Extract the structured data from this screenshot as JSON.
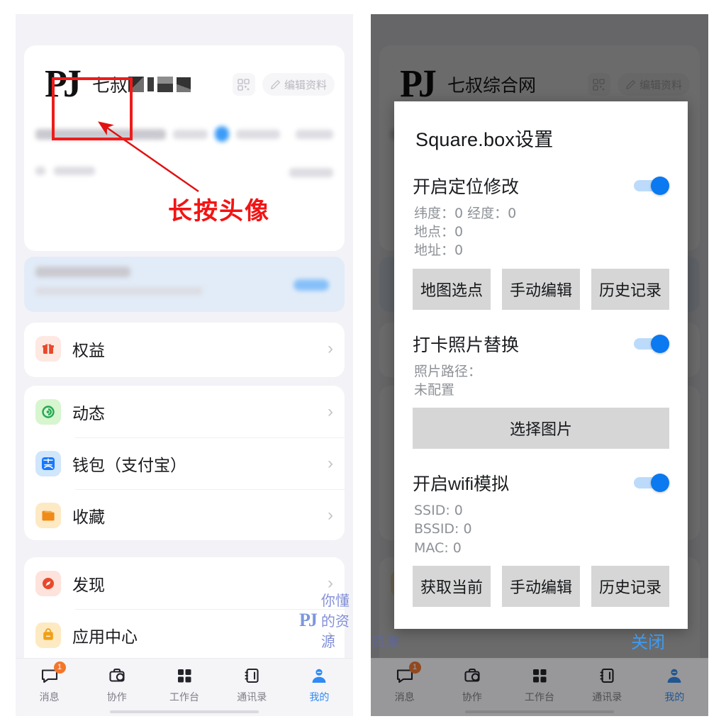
{
  "app": {
    "profile": {
      "avatar_logo": "PJ",
      "name": "七叔",
      "name_right": "七叔综合网",
      "qr_icon": "qr-code-icon",
      "edit_icon": "pencil-icon",
      "edit_label": "编辑资料"
    },
    "menu_groups": [
      {
        "items": [
          {
            "icon": "gift-icon",
            "label": "权益",
            "chevron": "›"
          }
        ]
      },
      {
        "items": [
          {
            "icon": "moments-eye-icon",
            "label": "动态",
            "chevron": "›"
          },
          {
            "icon": "alipay-icon",
            "label": "钱包（支付宝）",
            "chevron": "›"
          },
          {
            "icon": "folder-star-icon",
            "label": "收藏",
            "chevron": "›"
          }
        ]
      },
      {
        "items": [
          {
            "icon": "compass-icon",
            "label": "发现",
            "chevron": "›"
          },
          {
            "icon": "app-center-icon",
            "label": "应用中心",
            "chevron": "›"
          }
        ]
      }
    ],
    "tabbar": [
      {
        "icon": "message-icon",
        "label": "消息",
        "badge": "1",
        "active": false
      },
      {
        "icon": "briefcase-icon",
        "label": "协作",
        "badge": "",
        "active": false
      },
      {
        "icon": "grid-icon",
        "label": "工作台",
        "badge": "",
        "active": false
      },
      {
        "icon": "contacts-icon",
        "label": "通讯录",
        "badge": "",
        "active": false
      },
      {
        "icon": "person-icon",
        "label": "我的",
        "badge": "",
        "active": true
      }
    ]
  },
  "annotation": {
    "caption": "长按头像",
    "box_color": "#ef1b1b",
    "text_color": "#f21414"
  },
  "watermark": {
    "logo": "PJ",
    "text": "你懂的资源"
  },
  "dialog": {
    "title": "Square.box设置",
    "sections": [
      {
        "title": "开启定位修改",
        "toggle_on": true,
        "meta": "纬度：0  经度：0\n地点：0\n地址：0",
        "buttons": [
          "地图选点",
          "手动编辑",
          "历史记录"
        ]
      },
      {
        "title": "打卡照片替换",
        "toggle_on": true,
        "meta": "照片路径：\n未配置",
        "buttons": [
          "选择图片"
        ]
      },
      {
        "title": "开启wifi模拟",
        "toggle_on": true,
        "meta": "SSID: 0\nBSSID: 0\nMAC: 0",
        "buttons": [
          "获取当前",
          "手动编辑",
          "历史记录"
        ]
      }
    ],
    "close_label": "关闭",
    "accent_color": "#0b79f0",
    "button_bg": "#d6d6d6"
  }
}
